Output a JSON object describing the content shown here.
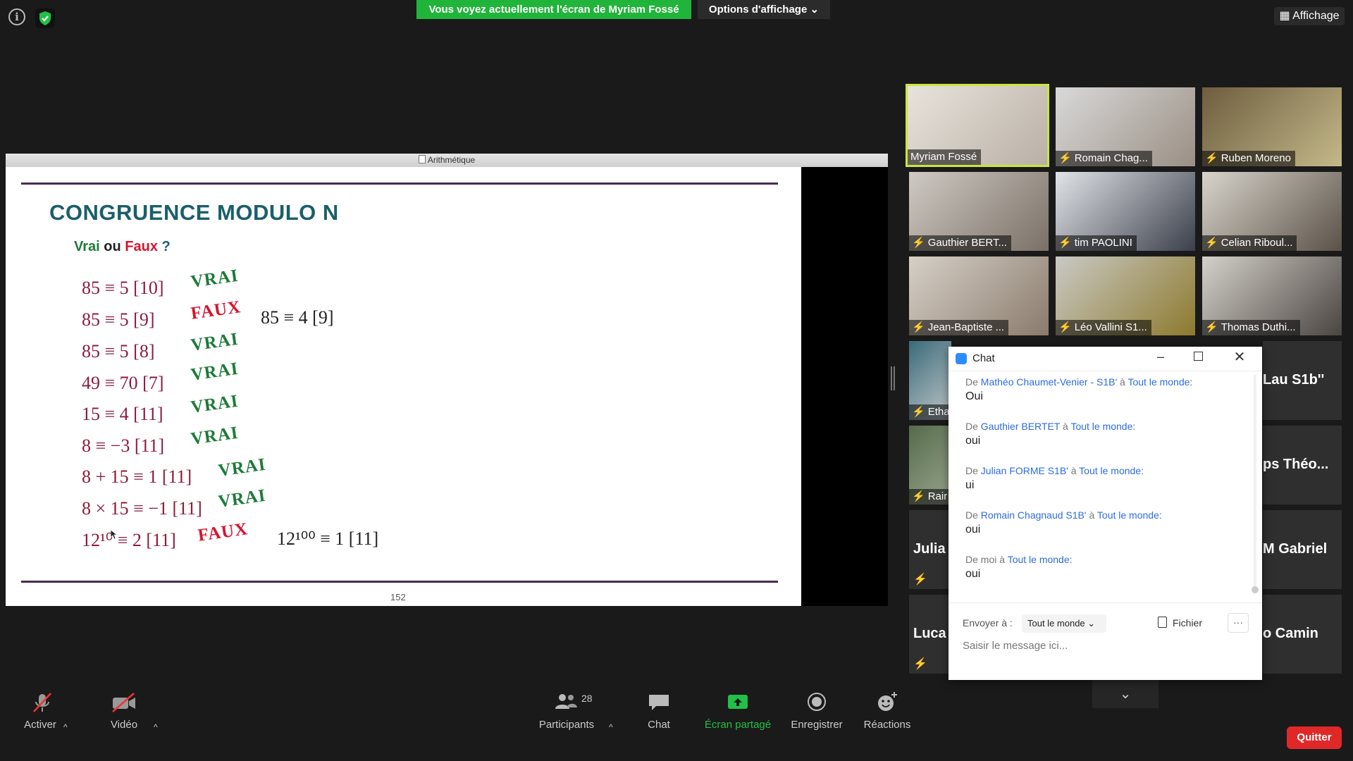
{
  "top_bar": {
    "share_banner": "Vous voyez actuellement l'écran de Myriam Fossé",
    "view_options": "Options d'affichage",
    "affichage": "Affichage"
  },
  "shared_window": {
    "title": "Arithmétique",
    "slide": {
      "title": "CONGRUENCE MODULO N",
      "subtitle_vrai": "Vrai",
      "subtitle_ou": "ou",
      "subtitle_faux": "Faux",
      "subtitle_q": "?",
      "rows": [
        {
          "expr": "85 ≡ 5  [10]",
          "verdict": "VRAI",
          "correction": ""
        },
        {
          "expr": "85 ≡ 5  [9]",
          "verdict": "FAUX",
          "correction": "85 ≡ 4  [9]"
        },
        {
          "expr": "85 ≡ 5  [8]",
          "verdict": "VRAI",
          "correction": ""
        },
        {
          "expr": "49 ≡ 70 [7]",
          "verdict": "VRAI",
          "correction": ""
        },
        {
          "expr": "15 ≡ 4 [11]",
          "verdict": "VRAI",
          "correction": ""
        },
        {
          "expr": "8  ≡ −3 [11]",
          "verdict": "VRAI",
          "correction": ""
        },
        {
          "expr": "8 + 15 ≡ 1 [11]",
          "verdict": "VRAI",
          "correction": ""
        },
        {
          "expr": "8 × 15 ≡ −1 [11]",
          "verdict": "VRAI",
          "correction": ""
        },
        {
          "expr": "12¹⁰ ≡ 2 [11]",
          "verdict": "FAUX",
          "correction": "12¹⁰⁰ ≡ 1 [11]"
        }
      ],
      "page_number": "152"
    }
  },
  "participants_tiles": [
    {
      "name": "Myriam Fossé",
      "muted": false
    },
    {
      "name": "Romain Chag...",
      "muted": true
    },
    {
      "name": "Ruben Moreno",
      "muted": true
    },
    {
      "name": "Gauthier BERT...",
      "muted": true
    },
    {
      "name": "tim PAOLINI",
      "muted": true
    },
    {
      "name": "Celian Riboul...",
      "muted": true
    },
    {
      "name": "Jean-Baptiste ...",
      "muted": true
    },
    {
      "name": "Léo Vallini S1...",
      "muted": true
    },
    {
      "name": "Thomas Duthi...",
      "muted": true
    }
  ],
  "hidden_tiles": {
    "etha": "Etha",
    "rain": "Rair",
    "julia": "Julia",
    "luca": "Luca",
    "lau": "Lau S1b''",
    "theo": "ps  Théo...",
    "gabriel": "M Gabriel",
    "camin": "o Camin"
  },
  "chat": {
    "title": "Chat",
    "messages": [
      {
        "prefix": "De",
        "sender": "Mathéo Chaumet-Venier - S1B'",
        "to_word": "à",
        "recipient": "Tout le monde:",
        "text": "Oui"
      },
      {
        "prefix": "De",
        "sender": "Gauthier BERTET",
        "to_word": "à",
        "recipient": "Tout le monde:",
        "text": "oui"
      },
      {
        "prefix": "De",
        "sender": "Julian FORME S1B'",
        "to_word": "à",
        "recipient": "Tout le monde:",
        "text": "ui"
      },
      {
        "prefix": "De",
        "sender": "Romain Chagnaud S1B'",
        "to_word": "à",
        "recipient": "Tout le monde:",
        "text": "oui"
      },
      {
        "prefix": "De moi",
        "sender": "",
        "to_word": "à",
        "recipient": "Tout le monde:",
        "text": "oui"
      }
    ],
    "send_to_label": "Envoyer à :",
    "send_to_value": "Tout le monde",
    "file_label": "Fichier",
    "more_label": "···",
    "input_placeholder": "Saisir le message ici..."
  },
  "toolbar": {
    "activer": "Activer",
    "video": "Vidéo",
    "participants": "Participants",
    "participants_count": "28",
    "chat": "Chat",
    "ecran_partage": "Écran partagé",
    "enregistrer": "Enregistrer",
    "reactions": "Réactions",
    "quitter": "Quitter"
  },
  "colors": {
    "share_green": "#21b43b",
    "quit_red": "#e02828",
    "slide_title": "#1b5f6a",
    "vrai_green": "#1e7a3a",
    "faux_red": "#d61530",
    "chat_link_blue": "#2d6cdf"
  }
}
